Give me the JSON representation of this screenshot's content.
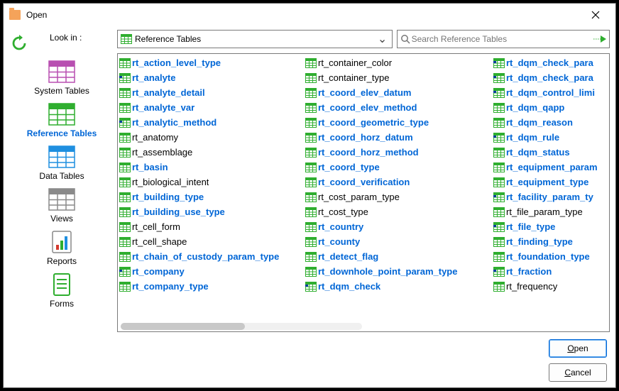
{
  "title": "Open",
  "toolbar": {
    "lookin_label": "Look in :",
    "lookin_value": "Reference Tables",
    "search_placeholder": "Search Reference Tables"
  },
  "sidebar": {
    "items": [
      {
        "label": "System Tables",
        "color": "#b84fb1",
        "selected": false,
        "kind": "table"
      },
      {
        "label": "Reference Tables",
        "color": "#2fae2f",
        "selected": true,
        "kind": "table"
      },
      {
        "label": "Data Tables",
        "color": "#1f8fe0",
        "selected": false,
        "kind": "table"
      },
      {
        "label": "Views",
        "color": "#8a8a8a",
        "selected": false,
        "kind": "table"
      },
      {
        "label": "Reports",
        "color": "#2fae2f",
        "selected": false,
        "kind": "report"
      },
      {
        "label": "Forms",
        "color": "#2fae2f",
        "selected": false,
        "kind": "form"
      }
    ]
  },
  "columns": [
    [
      {
        "name": "rt_action_level_type",
        "blue": true,
        "mark": false
      },
      {
        "name": "rt_analyte",
        "blue": true,
        "mark": true
      },
      {
        "name": "rt_analyte_detail",
        "blue": true,
        "mark": false
      },
      {
        "name": "rt_analyte_var",
        "blue": true,
        "mark": false
      },
      {
        "name": "rt_analytic_method",
        "blue": true,
        "mark": true
      },
      {
        "name": "rt_anatomy",
        "blue": false,
        "mark": false
      },
      {
        "name": "rt_assemblage",
        "blue": false,
        "mark": false
      },
      {
        "name": "rt_basin",
        "blue": true,
        "mark": false
      },
      {
        "name": "rt_biological_intent",
        "blue": false,
        "mark": false
      },
      {
        "name": "rt_building_type",
        "blue": true,
        "mark": false
      },
      {
        "name": "rt_building_use_type",
        "blue": true,
        "mark": false
      },
      {
        "name": "rt_cell_form",
        "blue": false,
        "mark": false
      },
      {
        "name": "rt_cell_shape",
        "blue": false,
        "mark": false
      },
      {
        "name": "rt_chain_of_custody_param_type",
        "blue": true,
        "mark": false
      },
      {
        "name": "rt_company",
        "blue": true,
        "mark": true
      },
      {
        "name": "rt_company_type",
        "blue": true,
        "mark": false
      }
    ],
    [
      {
        "name": "rt_container_color",
        "blue": false,
        "mark": false
      },
      {
        "name": "rt_container_type",
        "blue": false,
        "mark": false
      },
      {
        "name": "rt_coord_elev_datum",
        "blue": true,
        "mark": false
      },
      {
        "name": "rt_coord_elev_method",
        "blue": true,
        "mark": false
      },
      {
        "name": "rt_coord_geometric_type",
        "blue": true,
        "mark": false
      },
      {
        "name": "rt_coord_horz_datum",
        "blue": true,
        "mark": false
      },
      {
        "name": "rt_coord_horz_method",
        "blue": true,
        "mark": false
      },
      {
        "name": "rt_coord_type",
        "blue": true,
        "mark": false
      },
      {
        "name": "rt_coord_verification",
        "blue": true,
        "mark": false
      },
      {
        "name": "rt_cost_param_type",
        "blue": false,
        "mark": false
      },
      {
        "name": "rt_cost_type",
        "blue": false,
        "mark": false
      },
      {
        "name": "rt_country",
        "blue": true,
        "mark": false
      },
      {
        "name": "rt_county",
        "blue": true,
        "mark": false
      },
      {
        "name": "rt_detect_flag",
        "blue": true,
        "mark": false
      },
      {
        "name": "rt_downhole_point_param_type",
        "blue": true,
        "mark": false
      },
      {
        "name": "rt_dqm_check",
        "blue": true,
        "mark": true
      }
    ],
    [
      {
        "name": "rt_dqm_check_para",
        "blue": true,
        "mark": true
      },
      {
        "name": "rt_dqm_check_para",
        "blue": true,
        "mark": true
      },
      {
        "name": "rt_dqm_control_limi",
        "blue": true,
        "mark": true
      },
      {
        "name": "rt_dqm_qapp",
        "blue": true,
        "mark": false
      },
      {
        "name": "rt_dqm_reason",
        "blue": true,
        "mark": false
      },
      {
        "name": "rt_dqm_rule",
        "blue": true,
        "mark": true
      },
      {
        "name": "rt_dqm_status",
        "blue": true,
        "mark": false
      },
      {
        "name": "rt_equipment_param",
        "blue": true,
        "mark": false
      },
      {
        "name": "rt_equipment_type",
        "blue": true,
        "mark": false
      },
      {
        "name": "rt_facility_param_ty",
        "blue": true,
        "mark": true
      },
      {
        "name": "rt_file_param_type",
        "blue": false,
        "mark": false
      },
      {
        "name": "rt_file_type",
        "blue": true,
        "mark": true
      },
      {
        "name": "rt_finding_type",
        "blue": true,
        "mark": false
      },
      {
        "name": "rt_foundation_type",
        "blue": true,
        "mark": false
      },
      {
        "name": "rt_fraction",
        "blue": true,
        "mark": true
      },
      {
        "name": "rt_frequency",
        "blue": false,
        "mark": false
      }
    ]
  ],
  "buttons": {
    "open": "Open",
    "cancel": "Cancel"
  }
}
